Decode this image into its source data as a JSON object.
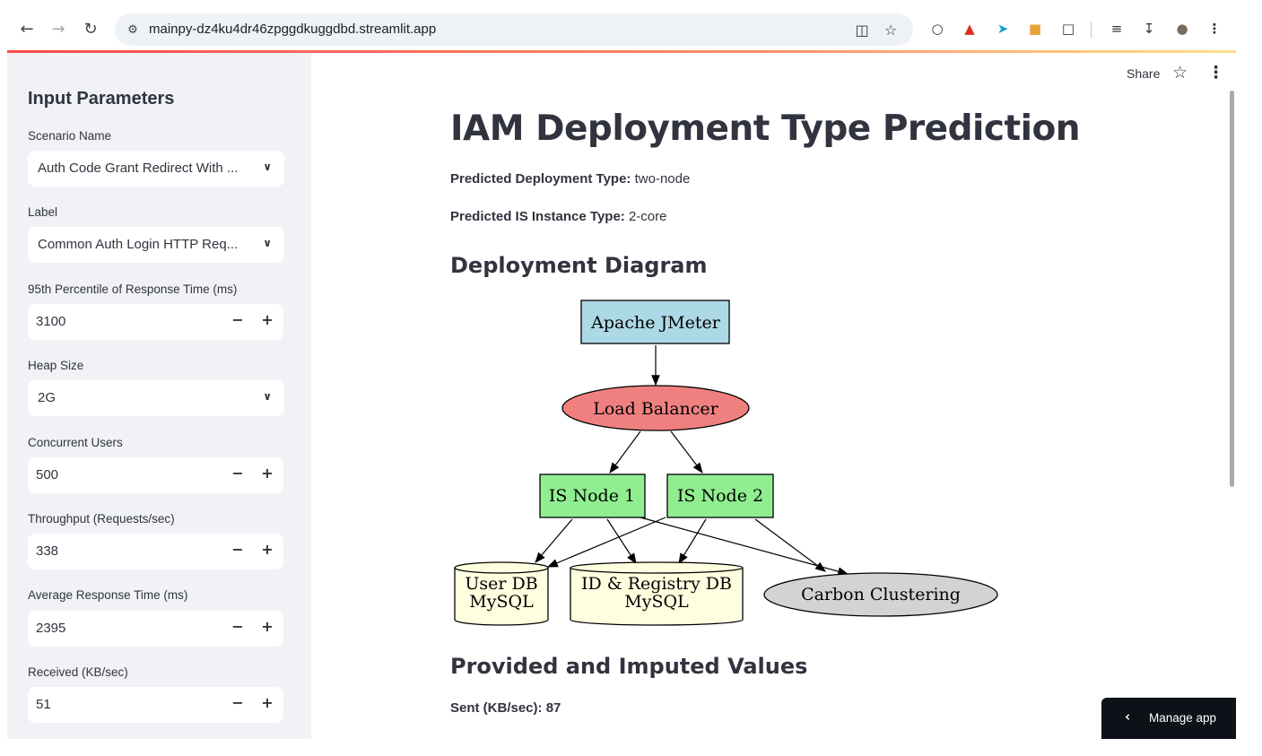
{
  "browser": {
    "url": "mainpy-dz4ku4dr46zpggdkuggdbd.streamlit.app"
  },
  "sidebar": {
    "title": "Input Parameters",
    "fields": [
      {
        "label": "Scenario Name",
        "value": "Auth Code Grant Redirect With ...",
        "kind": "select"
      },
      {
        "label": "Label",
        "value": "Common Auth Login HTTP Req...",
        "kind": "select"
      },
      {
        "label": "95th Percentile of Response Time (ms)",
        "value": "3100",
        "kind": "number"
      },
      {
        "label": "Heap Size",
        "value": "2G",
        "kind": "select"
      },
      {
        "label": "Concurrent Users",
        "value": "500",
        "kind": "number"
      },
      {
        "label": "Throughput (Requests/sec)",
        "value": "338",
        "kind": "number"
      },
      {
        "label": "Average Response Time (ms)",
        "value": "2395",
        "kind": "number"
      },
      {
        "label": "Received (KB/sec)",
        "value": "51",
        "kind": "number"
      }
    ]
  },
  "header": {
    "share_label": "Share"
  },
  "main": {
    "title": "IAM Deployment Type Prediction",
    "deployment_type_label": "Predicted Deployment Type:",
    "deployment_type_value": "two-node",
    "instance_type_label": "Predicted IS Instance Type:",
    "instance_type_value": "2-core",
    "diagram_heading": "Deployment Diagram",
    "values_heading": "Provided and Imputed Values",
    "sent_label": "Sent (KB/sec):",
    "sent_value": "87"
  },
  "diagram": {
    "jmeter": "Apache JMeter",
    "load_balancer": "Load Balancer",
    "is_node_1": "IS Node 1",
    "is_node_2": "IS Node 2",
    "user_db_line1": "User DB",
    "user_db_line2": "MySQL",
    "registry_db_line1": "ID & Registry DB",
    "registry_db_line2": "MySQL",
    "clustering": "Carbon Clustering",
    "colors": {
      "jmeter": "#add8e6",
      "load_balancer": "#f08080",
      "is_node": "#90ee90",
      "db": "#ffffe0",
      "clustering": "#d3d3d3"
    }
  },
  "footer": {
    "manage_app": "Manage app"
  }
}
